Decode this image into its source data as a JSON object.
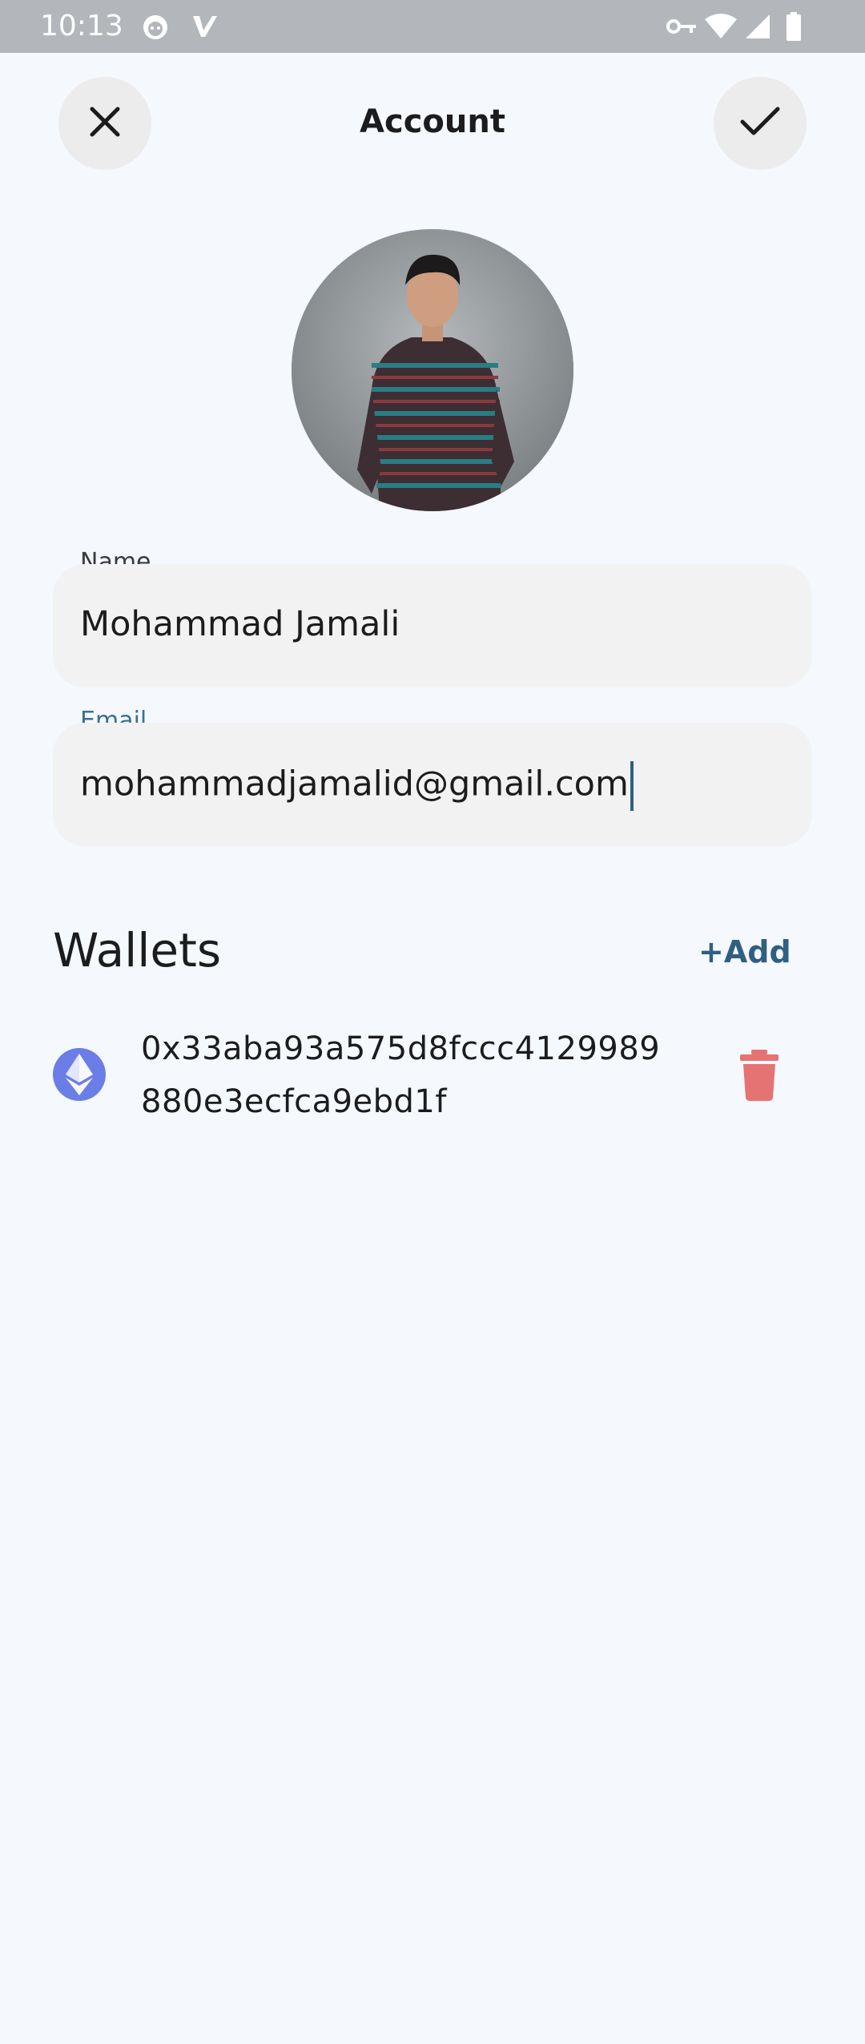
{
  "status_bar": {
    "time": "10:13",
    "icons": [
      "cat-notification-icon",
      "app-notification-icon",
      "key-icon",
      "wifi-icon",
      "signal-icon",
      "battery-icon"
    ]
  },
  "header": {
    "title": "Account",
    "close_icon": "close-icon",
    "confirm_icon": "check-icon"
  },
  "profile": {
    "avatar": "profile-photo"
  },
  "form": {
    "name": {
      "label": "Name",
      "value": "Mohammad Jamali"
    },
    "email": {
      "label": "Email",
      "value": "mohammadjamalid@gmail.com",
      "focused": true
    }
  },
  "wallets": {
    "title": "Wallets",
    "add_label": "+Add",
    "items": [
      {
        "icon": "ethereum-icon",
        "address_line1": "0x33aba93a575d8fccc4129989",
        "address_line2": "880e3ecfca9ebd1f",
        "delete_icon": "trash-icon"
      }
    ]
  },
  "colors": {
    "background": "#f5f8fc",
    "accent": "#2f5f83",
    "field_bg": "#f2f2f2",
    "delete": "#e57373",
    "ethereum": "#6a7ee6"
  }
}
